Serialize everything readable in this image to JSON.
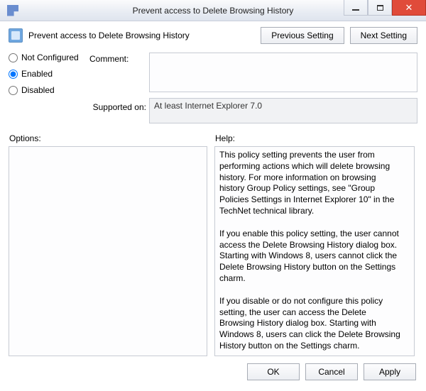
{
  "window": {
    "title": "Prevent access to Delete Browsing History"
  },
  "header": {
    "policy_title": "Prevent access to Delete Browsing History"
  },
  "nav": {
    "prev": "Previous Setting",
    "next": "Next Setting"
  },
  "state": {
    "options": [
      "Not Configured",
      "Enabled",
      "Disabled"
    ],
    "selected": "Enabled"
  },
  "fields": {
    "comment_label": "Comment:",
    "comment_value": "",
    "supported_label": "Supported on:",
    "supported_value": "At least Internet Explorer 7.0"
  },
  "panels": {
    "options_label": "Options:",
    "help_label": "Help:",
    "help_text": "This policy setting prevents the user from performing actions which will delete browsing history. For more information on browsing history Group Policy settings, see \"Group Policies Settings in Internet Explorer 10\" in the TechNet technical library.\n\nIf you enable this policy setting, the user cannot access the Delete Browsing History dialog box. Starting with Windows 8, users cannot click the Delete Browsing History button on the Settings charm.\n\nIf you disable or do not configure this policy setting, the user can access the Delete Browsing History dialog box. Starting with Windows 8, users can click the Delete Browsing History button on the Settings charm."
  },
  "buttons": {
    "ok": "OK",
    "cancel": "Cancel",
    "apply": "Apply"
  }
}
